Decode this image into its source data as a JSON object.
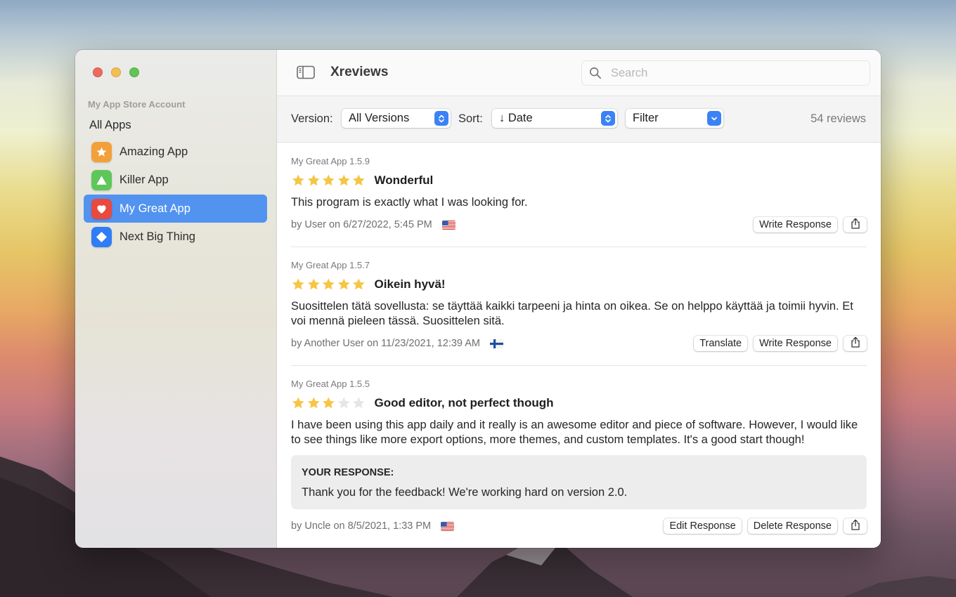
{
  "window": {
    "title": "Xreviews",
    "traffic_lights": [
      "close",
      "minimize",
      "zoom"
    ]
  },
  "sidebar": {
    "section_header": "My App Store Account",
    "all_apps_label": "All Apps",
    "items": [
      {
        "label": "Amazing App",
        "icon": "star-icon",
        "color": "#f2a03a",
        "selected": false
      },
      {
        "label": "Killer App",
        "icon": "triangle-icon",
        "color": "#5fc75a",
        "selected": false
      },
      {
        "label": "My Great App",
        "icon": "heart-icon",
        "color": "#e9493f",
        "selected": true
      },
      {
        "label": "Next Big Thing",
        "icon": "diamond-icon",
        "color": "#2f7cf6",
        "selected": false
      }
    ]
  },
  "search": {
    "placeholder": "Search",
    "value": ""
  },
  "toolbar": {
    "version_label": "Version:",
    "version_value": "All Versions",
    "sort_label": "Sort:",
    "sort_value": "↓ Date",
    "filter_value": "Filter",
    "review_count": "54 reviews"
  },
  "reviews": [
    {
      "version": "My Great App 1.5.9",
      "rating": 5,
      "title": "Wonderful",
      "body": "This program is exactly what I was looking for.",
      "meta": "by User on 6/27/2022, 5:45 PM",
      "flag": "US",
      "actions": [
        "Write Response"
      ]
    },
    {
      "version": "My Great App 1.5.7",
      "rating": 5,
      "title": "Oikein hyvä!",
      "body": "Suosittelen tätä sovellusta: se täyttää kaikki tarpeeni ja hinta on oikea. Se on helppo käyttää ja toimii hyvin. Et voi mennä pieleen tässä. Suosittelen sitä.",
      "meta": "by Another User on 11/23/2021, 12:39 AM",
      "flag": "FI",
      "actions": [
        "Translate",
        "Write Response"
      ]
    },
    {
      "version": "My Great App 1.5.5",
      "rating": 3,
      "title": "Good editor, not perfect though",
      "body": "I have been using this app daily and it really is an awesome editor and piece of software. However, I would like to see things like more export options, more themes, and custom templates. It's a good start though!",
      "response_label": "YOUR RESPONSE:",
      "response_text": "Thank you for the feedback! We're working hard on version 2.0.",
      "meta": "by Uncle on 8/5/2021, 1:33 PM",
      "flag": "US",
      "actions": [
        "Edit Response",
        "Delete Response"
      ]
    }
  ],
  "colors": {
    "accent": "#5293f0",
    "star_filled": "#f6c643",
    "star_empty": "#e6e6e6",
    "control_blue": "#3b82f6"
  }
}
